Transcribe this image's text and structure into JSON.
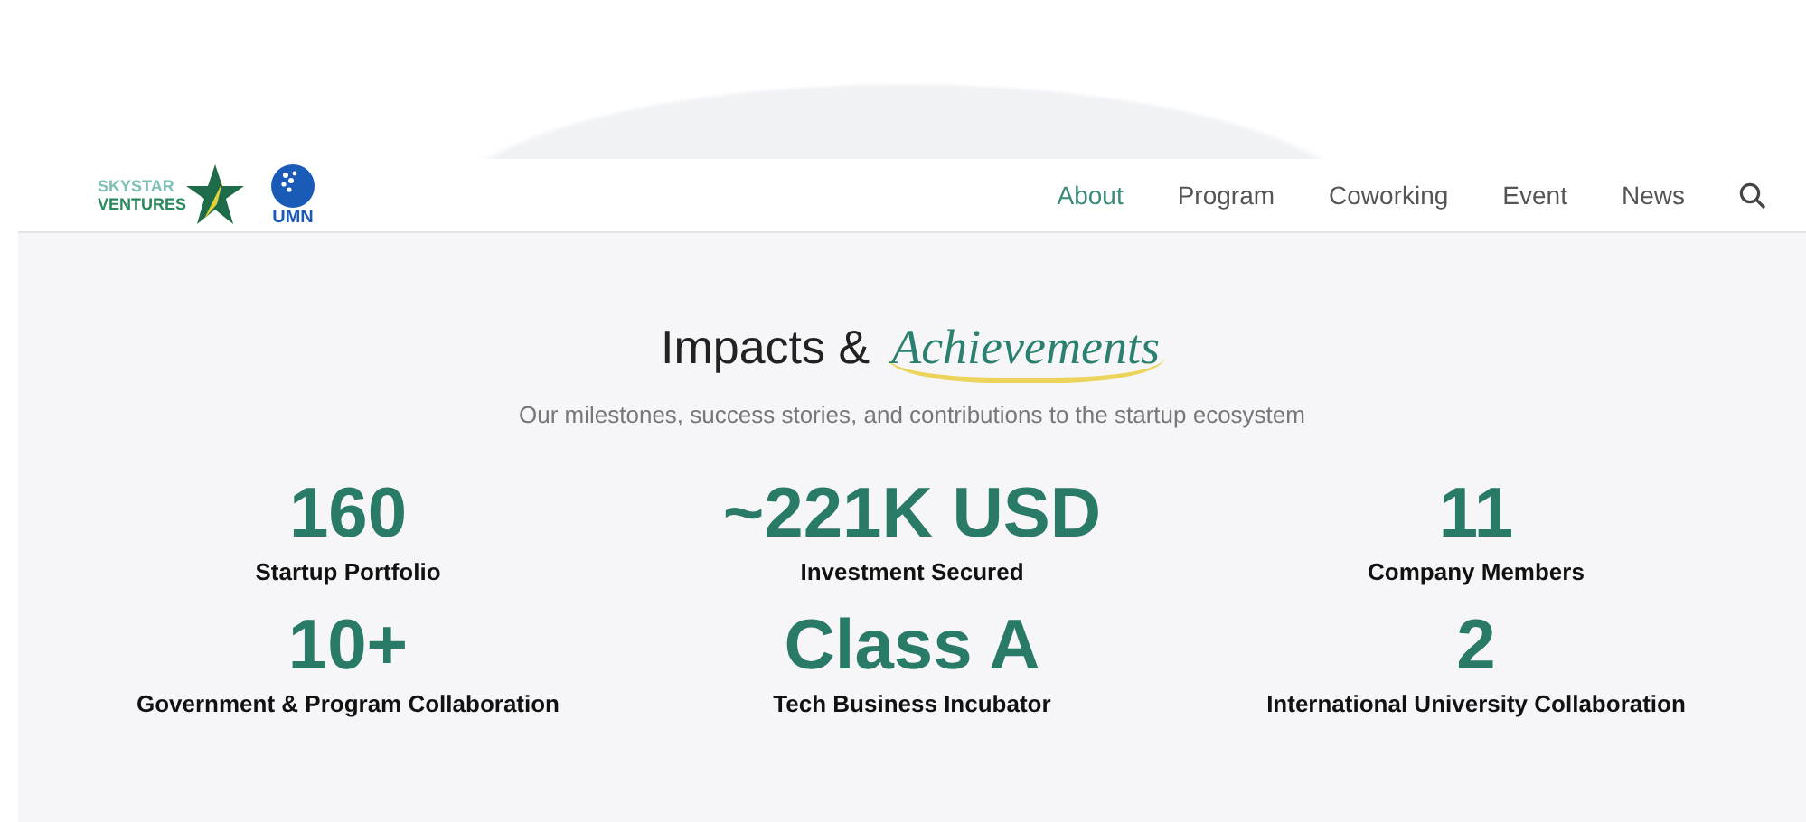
{
  "header": {
    "logos": [
      {
        "kind": "skystar",
        "line1": "SKYSTAR",
        "line2": "VENTURES"
      },
      {
        "kind": "umn",
        "text": "UMN"
      }
    ],
    "nav": [
      {
        "label": "About",
        "selected": true
      },
      {
        "label": "Program",
        "selected": false
      },
      {
        "label": "Coworking",
        "selected": false
      },
      {
        "label": "Event",
        "selected": false
      },
      {
        "label": "News",
        "selected": false
      }
    ]
  },
  "section": {
    "title": "Impacts &",
    "title_accent": "Achievements",
    "subtitle": "Our milestones, success stories, and contributions to the startup ecosystem",
    "stats": [
      {
        "value": "160",
        "label": "Startup Portfolio"
      },
      {
        "value": "~221K USD",
        "label": "Investment Secured"
      },
      {
        "value": "11",
        "label": "Company Members"
      },
      {
        "value": "10+",
        "label": "Government & Program Collaboration"
      },
      {
        "value": "Class A",
        "label": "Tech Business Incubator"
      },
      {
        "value": "2",
        "label": "International University Collaboration"
      }
    ]
  }
}
